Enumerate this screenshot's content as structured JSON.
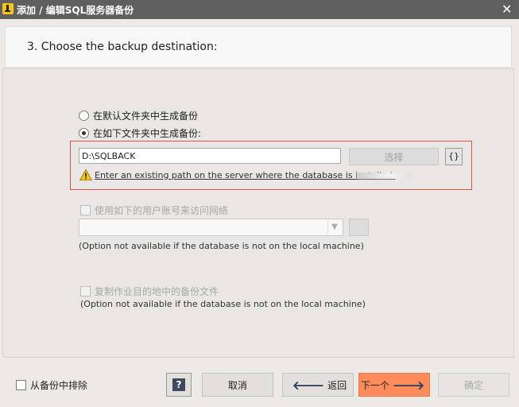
{
  "window": {
    "title": "添加 / 编辑SQL服务器备份",
    "close_icon": "close-icon"
  },
  "header": {
    "step_title": "3. Choose the backup destination:"
  },
  "destination": {
    "option_default": "在默认文件夹中生成备份",
    "option_custom": "在如下文件夹中生成备份:",
    "selected": "custom",
    "path_value": "D:\\SQLBACK",
    "choose_label": "选择",
    "brace_label": "{}",
    "warning_text": "Enter an existing path on the server where the database is installed:",
    "warning_color": "#f5c518"
  },
  "network": {
    "use_account_label": "使用如下的用户账号来访问网络",
    "use_account_checked": false,
    "account_value": "",
    "note": "(Option not available if the database is not on the local machine)"
  },
  "copy": {
    "copy_label": "复制作业目的地中的备份文件",
    "copy_checked": false,
    "note": "(Option not available if the database is not on the local machine)"
  },
  "footer": {
    "exclude_label": "从备份中排除",
    "exclude_checked": false,
    "help_label": "?",
    "cancel_label": "取消",
    "back_label": "返回",
    "next_label": "下一个",
    "ok_label": "确定",
    "accent_color": "#ff8c5a"
  }
}
